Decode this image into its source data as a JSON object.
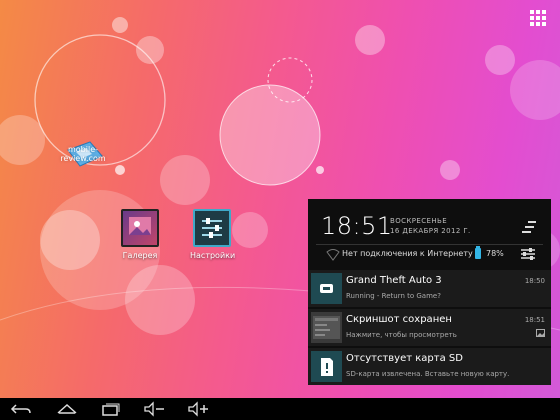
{
  "watermark": "mobile-review.com",
  "desktop": {
    "gallery_label": "Галерея",
    "settings_label": "Настройки"
  },
  "status": {
    "time": "18:51",
    "day_of_week": "ВОСКРЕСЕНЬЕ",
    "date": "16 ДЕКАБРЯ 2012 Г.",
    "network_text": "Нет подключения к Интернету",
    "battery_percent": "78%"
  },
  "notifications": [
    {
      "icon": "gamepad-icon",
      "title": "Grand Theft Auto 3",
      "subtitle": "Running - Return to Game?",
      "time": "18:50"
    },
    {
      "icon": "screenshot-icon",
      "title": "Скриншот сохранен",
      "subtitle": "Нажмите, чтобы просмотреть",
      "time": "18:51"
    },
    {
      "icon": "sd-card-icon",
      "title": "Отсутствует карта SD",
      "subtitle": "SD-карта извлечена. Вставьте новую карту.",
      "time": ""
    }
  ],
  "colors": {
    "accent": "#33b5e5",
    "panel_bg": "#0e0e0e",
    "notification_bg": "#1b1b1b"
  }
}
